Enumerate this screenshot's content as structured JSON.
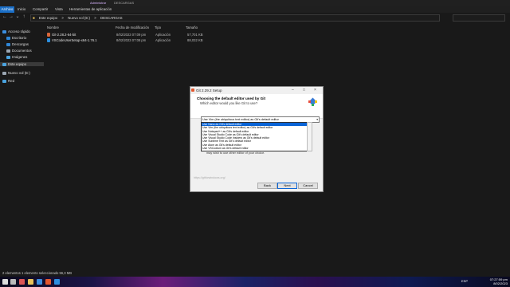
{
  "window": {
    "context_label": "Administrar",
    "title": "DESCARGAS"
  },
  "ribbon": {
    "tabs": [
      "Archivo",
      "Inicio",
      "Compartir",
      "Vista",
      "Herramientas de aplicación"
    ]
  },
  "address": {
    "parts": [
      "Este equipo",
      ">",
      "Nuevo vol (E:)",
      ">",
      "DESCARGAS"
    ]
  },
  "nav": {
    "quick_access": "Acceso rápido",
    "items": [
      "Escritorio",
      "Descargas",
      "Documentos",
      "Imágenes"
    ],
    "this_pc": "Este equipo",
    "drive": "Nuevo vol (E:)",
    "network": "Red"
  },
  "file_list": {
    "columns": [
      "Nombre",
      "Fecha de modificación",
      "Tipo",
      "Tamaño"
    ],
    "rows": [
      {
        "name": "Git-2.28.2-64-bit",
        "date": "8/02/2023 07:09 pm",
        "type": "Aplicación",
        "size": "57,701 KB"
      },
      {
        "name": "VSCodeUserSetup-x64-1.76.1",
        "date": "8/02/2023 07:08 pm",
        "type": "Aplicación",
        "size": "88,032 KB"
      }
    ]
  },
  "status_bar": {
    "text": "2 elementos   1 elemento seleccionado  56,3 MB"
  },
  "taskbar": {
    "lang": "ESP",
    "time": "07:27:59 pm",
    "date": "8/02/2023"
  },
  "dialog": {
    "title": "Git 2.29.2 Setup",
    "heading": "Choosing the default editor used by Git",
    "subheading": "Which editor would you like Git to use?",
    "selected": "Use Vim (the ubiquitous text editor) as Git's default editor",
    "options": [
      "Use Nano as Git's default editor",
      "Use Vim (the ubiquitous text editor) as Git's default editor",
      "Use Notepad++ as Git's default editor",
      "Use Visual Studio Code as Git's default editor",
      "Use Visual Studio Code Insiders as Git's default editor",
      "Use Sublime Text as Git's default editor",
      "Use Atom as Git's default editor",
      "Use VSCodium as Git's default editor"
    ],
    "selected_index": 0,
    "note": "may wish to use other editor of your choice.",
    "url": "https://gitforwindows.org/",
    "buttons": {
      "back": "Back",
      "next": "Next",
      "cancel": "Cancel"
    }
  },
  "colors": {
    "accent": "#0a64d6",
    "ribbon_active": "#1b6fc7",
    "background": "#191919"
  }
}
